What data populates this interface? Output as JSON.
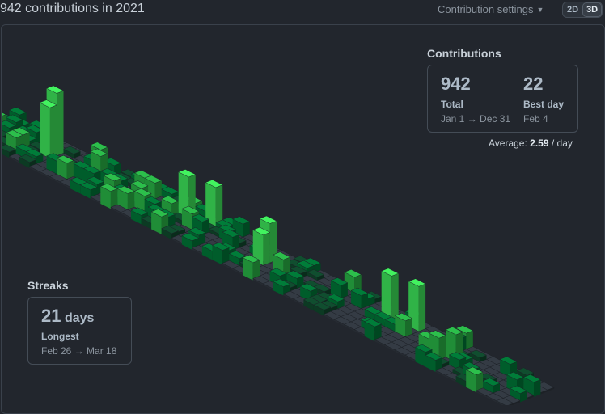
{
  "header": {
    "title": "942 contributions in 2021",
    "settings_label": "Contribution settings",
    "view_2d": "2D",
    "view_3d": "3D",
    "active_view": "3D"
  },
  "contributions": {
    "heading": "Contributions",
    "total_value": "942",
    "total_label": "Total",
    "total_range": "Jan 1 → Dec 31",
    "best_value": "22",
    "best_label": "Best day",
    "best_date": "Feb 4",
    "average_prefix": "Average:",
    "average_value": "2.59",
    "average_suffix": "/ day"
  },
  "streaks": {
    "heading": "Streaks",
    "longest_value": "21",
    "longest_unit": "days",
    "longest_label": "Longest",
    "longest_range": "Feb 26 → Mar 18"
  },
  "colors": {
    "background": "#22262d",
    "empty_cell": "#2d333b",
    "level1": "#0e4429",
    "level2": "#006d32",
    "level3": "#26a641",
    "level4": "#39d353"
  }
}
